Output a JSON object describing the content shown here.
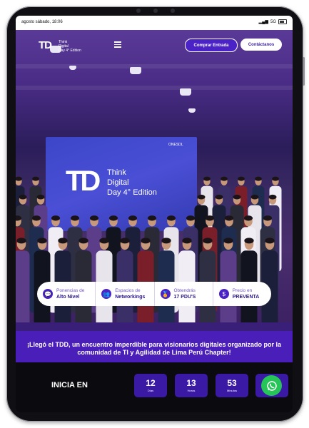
{
  "status_bar": {
    "time": "agosto sábado, 18:06",
    "network": "5G"
  },
  "header": {
    "logo_mark": "TD",
    "logo_lines": [
      "Think",
      "Digital",
      "Day 4° Edition"
    ],
    "buy_button": "Comprar Entrada",
    "contact_button": "Contáctanos"
  },
  "hero": {
    "screen_mark": "TD",
    "screen_lines": [
      "Think",
      "Digital",
      "Day 4° Edition"
    ],
    "screen_corner": "ONESDL"
  },
  "info_strip": [
    {
      "top": "Ponencias de",
      "bottom": "Alto Nivel",
      "icon": "chat-icon"
    },
    {
      "top": "Espacios de",
      "bottom": "Networkings",
      "icon": "people-icon"
    },
    {
      "top": "Obtendrás",
      "bottom": "17 PDU'S",
      "icon": "medal-icon"
    },
    {
      "top": "Precio en",
      "bottom": "PREVENTA",
      "icon": "dollar-icon"
    }
  ],
  "tagline": "¡Llegó el TDD, un encuentro imperdible para visionarios digitales organizado por la comunidad de TI y Agilidad de Lima Perú Chapter!",
  "countdown": {
    "label": "INICIA EN",
    "units": [
      {
        "value": "12",
        "unit": "Días"
      },
      {
        "value": "13",
        "unit": "Horas"
      },
      {
        "value": "53",
        "unit": "Minutos"
      }
    ]
  },
  "colors": {
    "brand": "#4a22c6",
    "dark": "#0a0a0f",
    "whatsapp": "#25c558"
  }
}
